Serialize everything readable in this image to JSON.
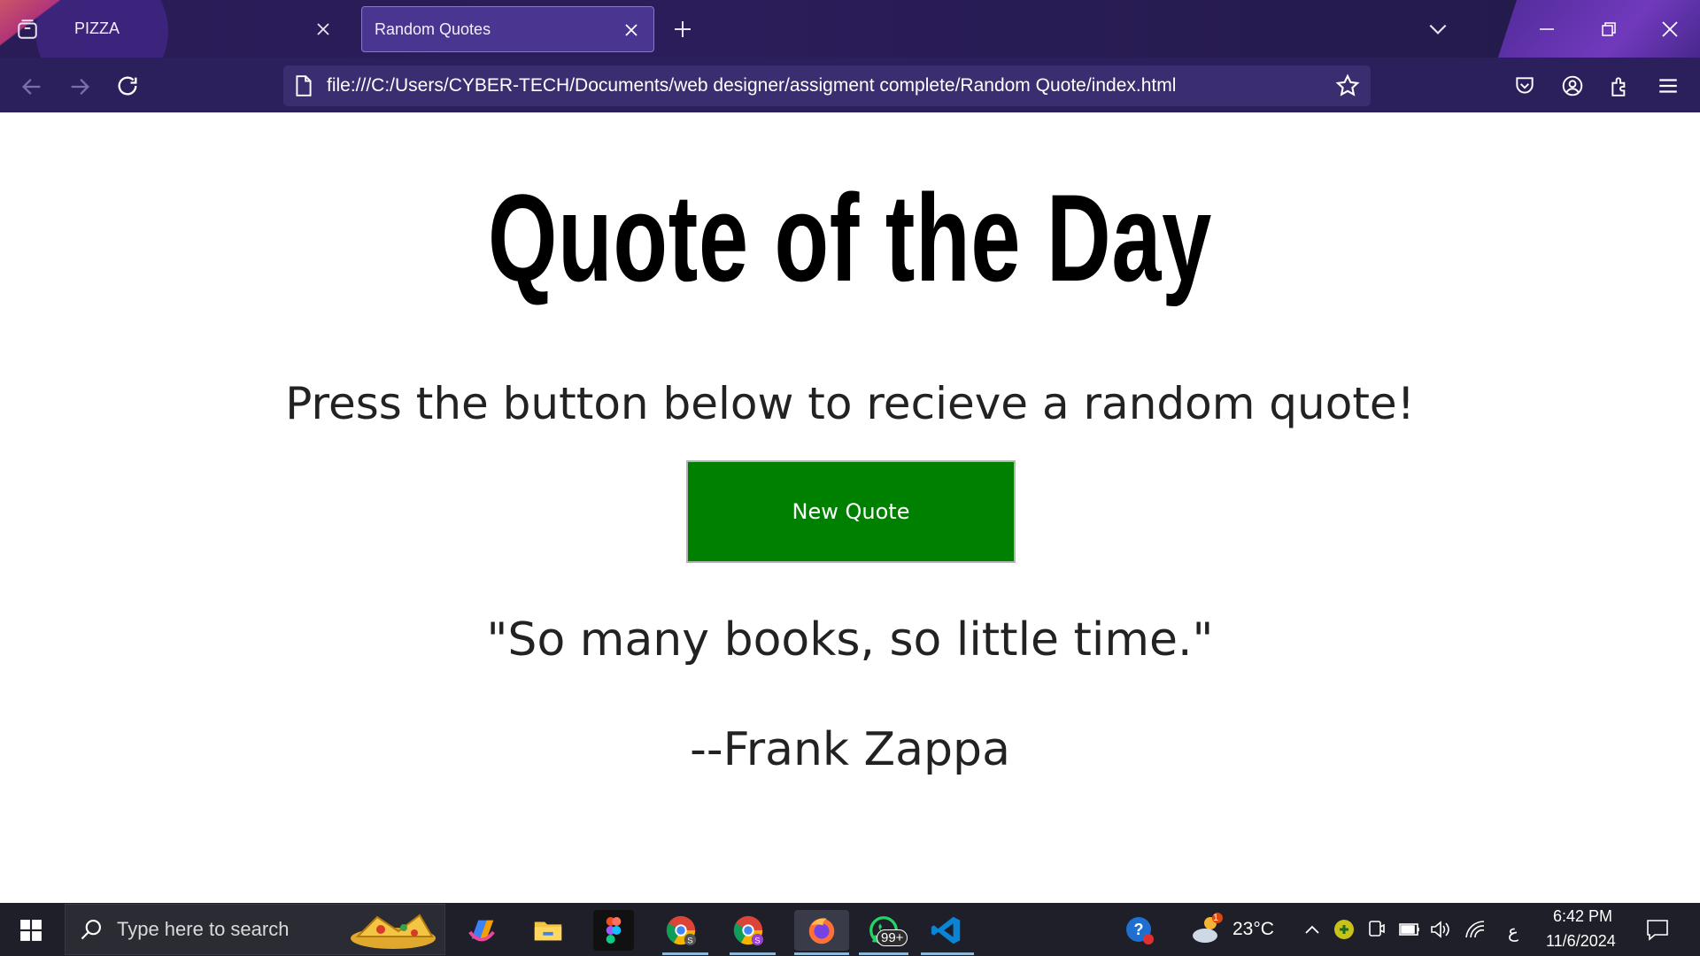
{
  "browser": {
    "tabs": [
      {
        "label": "PIZZA"
      },
      {
        "label": "Random Quotes"
      }
    ],
    "url": "file:///C:/Users/CYBER-TECH/Documents/web designer/assigment complete/Random Quote/index.html"
  },
  "page": {
    "title": "Quote of the Day",
    "subtitle": "Press the button below to recieve a random quote!",
    "button_label": "New Quote",
    "quote": "\"So many books, so little time.\"",
    "author": "--Frank Zappa",
    "button_color": "#008000"
  },
  "taskbar": {
    "search_placeholder": "Type here to search",
    "whatsapp_badge": "99+",
    "weather_badge": "1",
    "temperature": "23°C",
    "language": "ع",
    "time": "6:42 PM",
    "date": "11/6/2024",
    "icons": [
      "windows-start-icon",
      "search-icon",
      "copilot-icon",
      "file-explorer-icon",
      "figma-icon",
      "chrome-icon",
      "chrome-profile-icon",
      "firefox-icon",
      "whatsapp-icon",
      "vscode-icon",
      "help-icon",
      "weather-icon",
      "chevron-up-icon",
      "network-status-icon",
      "camera-icon",
      "battery-icon",
      "volume-icon",
      "wifi-icon",
      "notifications-icon"
    ]
  }
}
